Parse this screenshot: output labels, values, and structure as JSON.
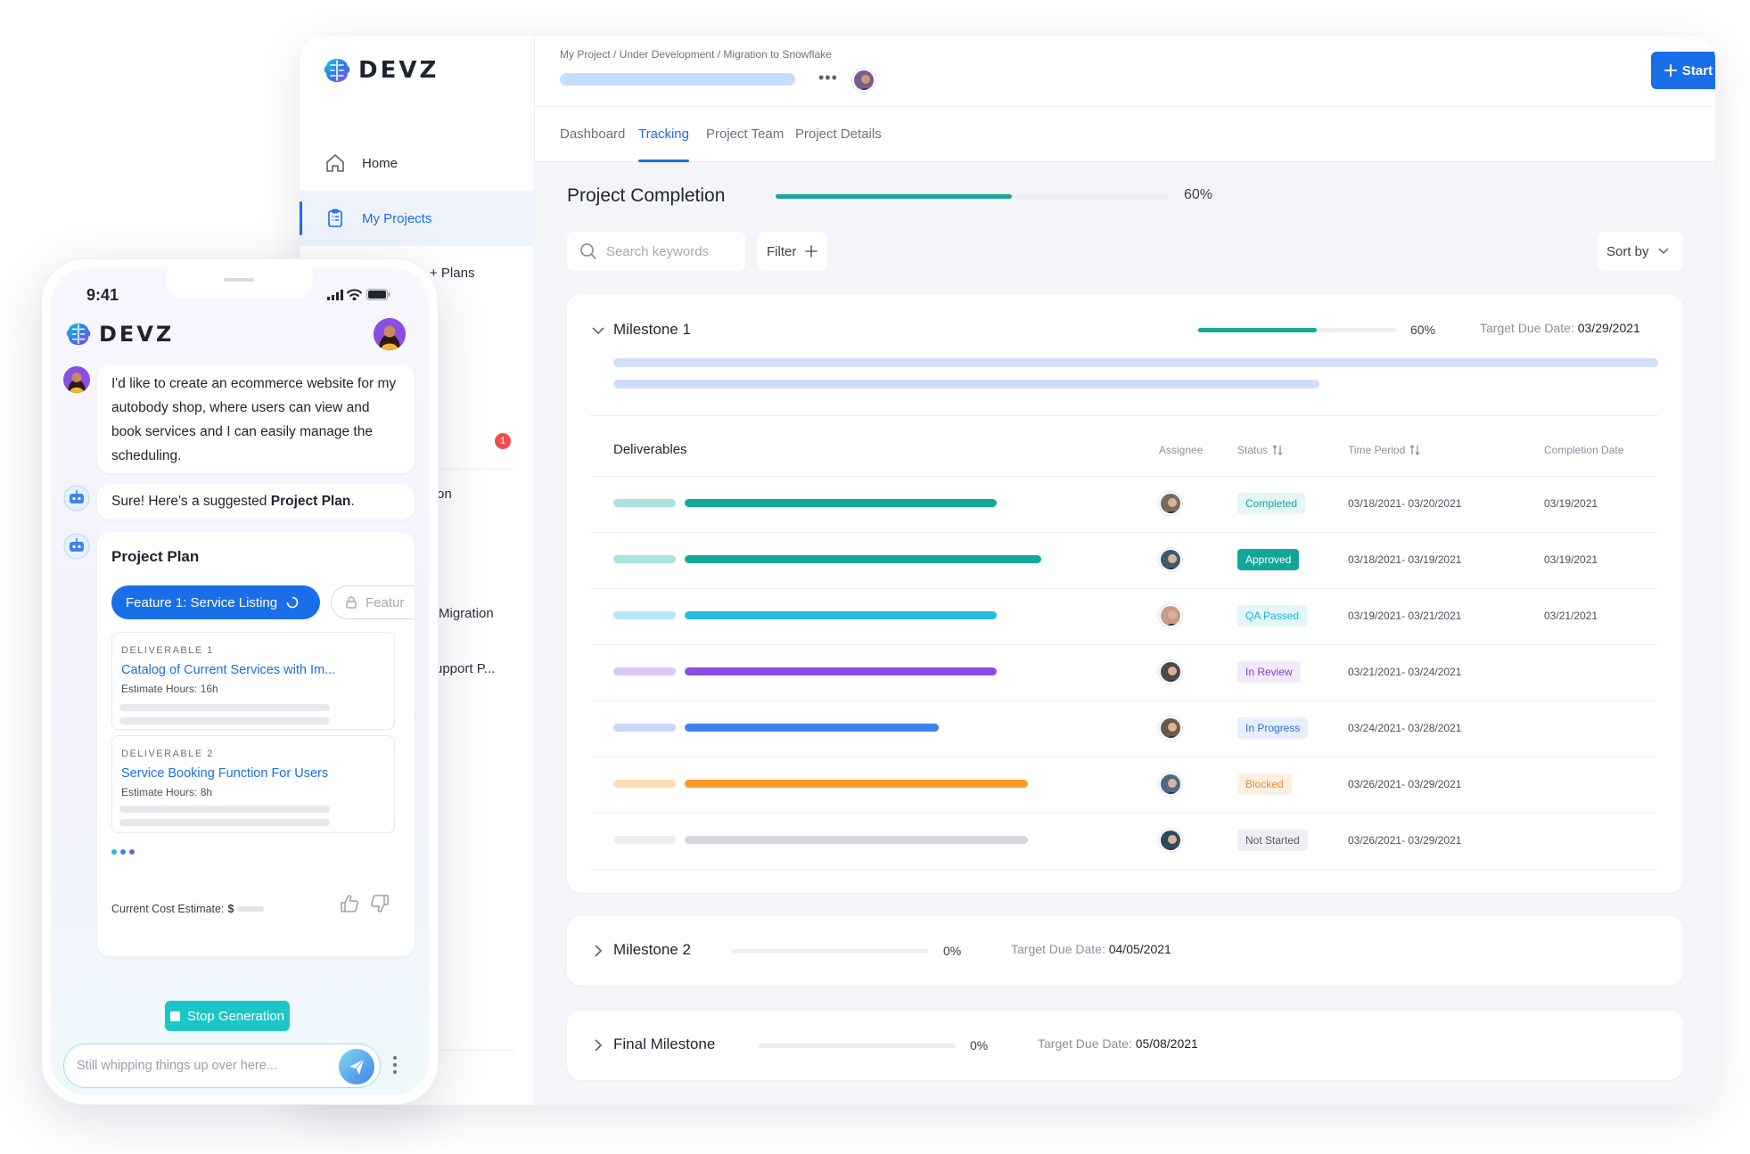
{
  "brand": {
    "name": "DEVZ"
  },
  "sidebar": {
    "items": [
      {
        "label": "Home",
        "icon": "home-icon"
      },
      {
        "label": "My Projects",
        "icon": "clipboard-icon"
      }
    ],
    "partial_items": [
      "+ Plans",
      "on",
      "Migration",
      "upport P..."
    ],
    "badge_count": "1"
  },
  "header": {
    "breadcrumb": "My Project / Under Development / Migration to Snowflake",
    "start_label": "Start"
  },
  "tabs": [
    {
      "label": "Dashboard"
    },
    {
      "label": "Tracking"
    },
    {
      "label": "Project Team"
    },
    {
      "label": "Project Details"
    }
  ],
  "completion": {
    "title": "Project Completion",
    "percent_label": "60%",
    "value": 0.6
  },
  "toolbar": {
    "search_placeholder": "Search keywords",
    "filter_label": "Filter",
    "sort_label": "Sort by"
  },
  "milestones": [
    {
      "name": "Milestone 1",
      "percent": "60%",
      "value": 0.6,
      "due_label": "Target Due Date:",
      "due": "03/29/2021"
    },
    {
      "name": "Milestone 2",
      "percent": "0%",
      "value": 0,
      "due_label": "Target Due Date:",
      "due": "04/05/2021"
    },
    {
      "name": "Final Milestone",
      "percent": "0%",
      "value": 0,
      "due_label": "Target Due Date:",
      "due": "05/08/2021"
    }
  ],
  "deliverables": {
    "headers": {
      "deliverables": "Deliverables",
      "assignee": "Assignee",
      "status": "Status",
      "time_period": "Time Period",
      "completion": "Completion Date"
    },
    "rows": [
      {
        "status": "Completed",
        "period": "03/18/2021- 03/20/2021",
        "completion": "03/19/2021",
        "color": "#14a899",
        "light": "#a8e3dd",
        "bg": "#e4f6f3",
        "fg": "#14a899"
      },
      {
        "status": "Approved",
        "period": "03/18/2021- 03/19/2021",
        "completion": "03/19/2021",
        "color": "#14a899",
        "light": "#a8e3dd",
        "bg": "#0fa896",
        "fg": "#ffffff"
      },
      {
        "status": "QA Passed",
        "period": "03/19/2021- 03/21/2021",
        "completion": "03/21/2021",
        "color": "#26bde4",
        "light": "#b4e8f5",
        "bg": "#e2f6fb",
        "fg": "#1fb6dc"
      },
      {
        "status": "In Review",
        "period": "03/21/2021- 03/24/2021",
        "completion": "",
        "color": "#8a4fe0",
        "light": "#d9c8f5",
        "bg": "#f1eafc",
        "fg": "#7a45d6"
      },
      {
        "status": "In Progress",
        "period": "03/24/2021- 03/28/2021",
        "completion": "",
        "color": "#3f82ec",
        "light": "#c6d9f8",
        "bg": "#e6effd",
        "fg": "#2f6fe0"
      },
      {
        "status": "Blocked",
        "period": "03/26/2021- 03/29/2021",
        "completion": "",
        "color": "#fb9a22",
        "light": "#fcdcb4",
        "bg": "#fdf0e2",
        "fg": "#f0892a"
      },
      {
        "status": "Not Started",
        "period": "03/26/2021- 03/29/2021",
        "completion": "",
        "color": "#d6d8dd",
        "light": "#eceef1",
        "bg": "#eeeff2",
        "fg": "#555b66"
      }
    ]
  },
  "phone": {
    "time": "9:41",
    "user_message": "I'd like to create an ecommerce website for my autobody shop, where users can view and book services and I can easily manage the scheduling.",
    "bot_intro_pre": "Sure! Here's a suggested ",
    "bot_intro_bold": "Project Plan",
    "bot_intro_post": ".",
    "plan_title": "Project Plan",
    "feature_active": "Feature 1: Service Listing",
    "feature_next": "Featur",
    "deliverables": [
      {
        "label": "DELIVERABLE 1",
        "title": "Catalog of Current Services with Im...",
        "hours": "Estimate Hours: 16h"
      },
      {
        "label": "DELIVERABLE 2",
        "title": "Service Booking Function For Users",
        "hours": "Estimate Hours: 8h"
      }
    ],
    "cost_label": "Current Cost Estimate:",
    "cost_symbol": "$",
    "stop_label": "Stop Generation",
    "input_placeholder": "Still whipping things up over here..."
  },
  "colors": {
    "accent": "#1a6fe8",
    "teal": "#14a899",
    "stop": "#1cc6c6"
  }
}
